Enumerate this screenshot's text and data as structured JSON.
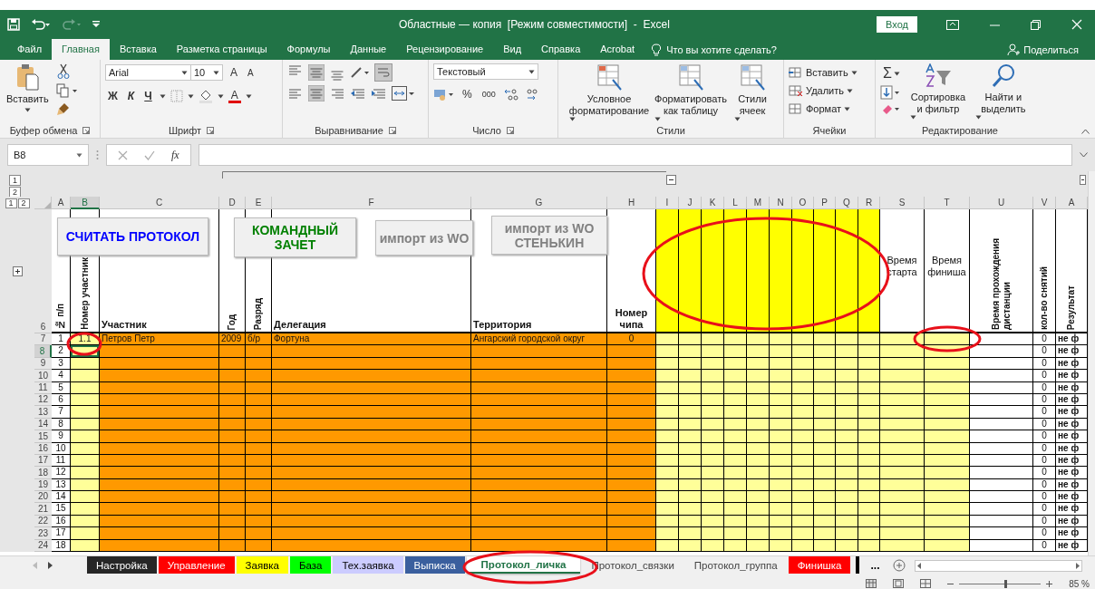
{
  "title_bar": {
    "title": "Областные — копия  [Режим совместимости]  -  Excel",
    "sign_in": "Вход"
  },
  "ribbon_tabs": [
    {
      "label": "Файл",
      "selected": false
    },
    {
      "label": "Главная",
      "selected": true
    },
    {
      "label": "Вставка",
      "selected": false
    },
    {
      "label": "Разметка страницы",
      "selected": false
    },
    {
      "label": "Формулы",
      "selected": false
    },
    {
      "label": "Данные",
      "selected": false
    },
    {
      "label": "Рецензирование",
      "selected": false
    },
    {
      "label": "Вид",
      "selected": false
    },
    {
      "label": "Справка",
      "selected": false
    },
    {
      "label": "Acrobat",
      "selected": false
    }
  ],
  "tell_me": "Что вы хотите сделать?",
  "share": "Поделиться",
  "ribbon": {
    "clipboard": {
      "paste": "Вставить",
      "label": "Буфер обмена"
    },
    "font": {
      "font_name": "Arial",
      "font_size": "10",
      "grow": "A",
      "shrink": "A",
      "bold": "Ж",
      "italic": "К",
      "underline": "Ч",
      "font_color": "A",
      "label": "Шрифт"
    },
    "alignment": {
      "label": "Выравнивание"
    },
    "number": {
      "format": "Текстовый",
      "percent": "%",
      "thousands": "000",
      "label": "Число"
    },
    "styles": {
      "buttons": [
        "Условное форматирование",
        "Форматировать как таблицу",
        "Стили ячеек"
      ],
      "label": "Стили"
    },
    "cells": {
      "buttons": [
        "Вставить",
        "Удалить",
        "Формат"
      ],
      "label": "Ячейки"
    },
    "editing": {
      "sum": "Σ",
      "buttons": [
        "Сортировка и фильтр",
        "Найти и выделить"
      ],
      "label": "Редактирование"
    }
  },
  "formula_bar": {
    "name_box": "B8",
    "function_label": "fx"
  },
  "outline": {
    "row_levels": [
      "1",
      "2"
    ],
    "column_levels": [
      "1",
      "2"
    ]
  },
  "sheet_buttons": [
    {
      "label": "СЧИТАТЬ ПРОТОКОЛ",
      "color": "#0000ff"
    },
    {
      "label": "КОМАНДНЫЙ ЗАЧЕТ",
      "color": "#008000"
    },
    {
      "label": "импорт из WO",
      "color": "#808080"
    },
    {
      "label": "импорт из WO СТЕНЬКИН",
      "color": "#808080"
    }
  ],
  "header_row": "6",
  "columns": [
    {
      "letter": "A",
      "header": "№ п/п",
      "kind": "vertical",
      "color": "#ffffff",
      "selected": false
    },
    {
      "letter": "B",
      "header": "Номер участник",
      "kind": "vertical",
      "color": "#ffff99",
      "selected": true
    },
    {
      "letter": "C",
      "header": "Участник",
      "kind": "bottom",
      "color": "#ff9900",
      "selected": false
    },
    {
      "letter": "D",
      "header": "Год",
      "kind": "vertical",
      "color": "#ff9900",
      "selected": false
    },
    {
      "letter": "E",
      "header": "Разряд",
      "kind": "vertical",
      "color": "#ff9900",
      "selected": false
    },
    {
      "letter": "F",
      "header": "Делегация",
      "kind": "bottom",
      "color": "#ff9900",
      "selected": false
    },
    {
      "letter": "G",
      "header": "Территория",
      "kind": "bottom",
      "color": "#ff9900",
      "selected": false
    },
    {
      "letter": "H",
      "header": "Номер чипа",
      "kind": "centered",
      "color": "#ff9900",
      "selected": false
    },
    {
      "letter": "I",
      "header_cell": {
        "color": "#ffff00"
      },
      "color": "#ffff99",
      "selected": false
    },
    {
      "letter": "J",
      "header_cell": {
        "color": "#ffff00"
      },
      "color": "#ffff99",
      "selected": false
    },
    {
      "letter": "K",
      "header_cell": {
        "color": "#ffff00"
      },
      "color": "#ffff99",
      "selected": false
    },
    {
      "letter": "L",
      "header_cell": {
        "color": "#ffff00"
      },
      "color": "#ffff99",
      "selected": false
    },
    {
      "letter": "M",
      "header_cell": {
        "color": "#ffff00"
      },
      "color": "#ffff99",
      "selected": false
    },
    {
      "letter": "N",
      "header_cell": {
        "color": "#ffff00"
      },
      "color": "#ffff99",
      "selected": false
    },
    {
      "letter": "O",
      "header_cell": {
        "color": "#ffff00"
      },
      "color": "#ffff99",
      "selected": false
    },
    {
      "letter": "P",
      "header_cell": {
        "color": "#ffff00"
      },
      "color": "#ffff99",
      "selected": false
    },
    {
      "letter": "Q",
      "header_cell": {
        "color": "#ffff00"
      },
      "color": "#ffff99",
      "selected": false
    },
    {
      "letter": "R",
      "header_cell": {
        "color": "#ffff00"
      },
      "color": "#ffff99",
      "selected": false
    },
    {
      "letter": "S",
      "header": "Время старта",
      "kind": "middle",
      "color": "#ffff99",
      "selected": false
    },
    {
      "letter": "T",
      "header": "Время финиша",
      "kind": "middle",
      "color": "#ffff99",
      "selected": false
    },
    {
      "letter": "U",
      "header": "Время прохождения дистанции",
      "kind": "vertical",
      "color": "#ffffff",
      "selected": false
    },
    {
      "letter": "V",
      "header": "кол-во снятий",
      "kind": "vertical",
      "color": "#ffffff",
      "selected": false
    },
    {
      "letter": "A",
      "header": "Результат",
      "kind": "vertical",
      "color": "#ffffff",
      "selected": false
    }
  ],
  "rows": [
    {
      "number": "7",
      "selected": false,
      "cells": [
        "1",
        "1.1",
        "Петров Петр",
        "2009",
        "б/р",
        "Фортуна",
        "Ангарский городской округ",
        "0"
      ],
      "removals": "0",
      "result": "не ф"
    },
    {
      "number": "8",
      "selected": true,
      "cells": [
        "2"
      ],
      "removals": "0",
      "result": "не ф"
    },
    {
      "number": "9",
      "selected": false,
      "cells": [
        "3"
      ],
      "removals": "0",
      "result": "не ф"
    },
    {
      "number": "10",
      "selected": false,
      "cells": [
        "4"
      ],
      "removals": "0",
      "result": "не ф"
    },
    {
      "number": "11",
      "selected": false,
      "cells": [
        "5"
      ],
      "removals": "0",
      "result": "не ф"
    },
    {
      "number": "12",
      "selected": false,
      "cells": [
        "6"
      ],
      "removals": "0",
      "result": "не ф"
    },
    {
      "number": "13",
      "selected": false,
      "cells": [
        "7"
      ],
      "removals": "0",
      "result": "не ф"
    },
    {
      "number": "14",
      "selected": false,
      "cells": [
        "8"
      ],
      "removals": "0",
      "result": "не ф"
    },
    {
      "number": "15",
      "selected": false,
      "cells": [
        "9"
      ],
      "removals": "0",
      "result": "не ф"
    },
    {
      "number": "16",
      "selected": false,
      "cells": [
        "10"
      ],
      "removals": "0",
      "result": "не ф"
    },
    {
      "number": "17",
      "selected": false,
      "cells": [
        "11"
      ],
      "removals": "0",
      "result": "не ф"
    },
    {
      "number": "18",
      "selected": false,
      "cells": [
        "12"
      ],
      "removals": "0",
      "result": "не ф"
    },
    {
      "number": "19",
      "selected": false,
      "cells": [
        "13"
      ],
      "removals": "0",
      "result": "не ф"
    },
    {
      "number": "20",
      "selected": false,
      "cells": [
        "14"
      ],
      "removals": "0",
      "result": "не ф"
    },
    {
      "number": "21",
      "selected": false,
      "cells": [
        "15"
      ],
      "removals": "0",
      "result": "не ф"
    },
    {
      "number": "22",
      "selected": false,
      "cells": [
        "16"
      ],
      "removals": "0",
      "result": "не ф"
    },
    {
      "number": "23",
      "selected": false,
      "cells": [
        "17"
      ],
      "removals": "0",
      "result": "не ф"
    },
    {
      "number": "24",
      "selected": false,
      "cells": [
        "18"
      ],
      "removals": "0",
      "result": "не ф"
    }
  ],
  "sheet_tabs": [
    {
      "label": "Настройка",
      "color": "#262626",
      "selected": false
    },
    {
      "label": "Управление",
      "color": "#ff0000",
      "selected": false
    },
    {
      "label": "Заявка",
      "color": "#ffff00",
      "selected": false
    },
    {
      "label": "База",
      "color": "#00ff00",
      "selected": false
    },
    {
      "label": "Тех.заявка",
      "color": "#ccccff",
      "selected": false
    },
    {
      "label": "Выписка",
      "color": "#3a5f9e",
      "selected": false
    },
    {
      "label": "Протокол_личка",
      "selected": true
    },
    {
      "label": "Протокол_связки",
      "selected": false
    },
    {
      "label": "Протокол_группа",
      "selected": false
    },
    {
      "label": "Финишка",
      "color": "#ff0000",
      "selected": false
    }
  ],
  "more_tabs": "...",
  "status_bar": {
    "zoom": "85 %",
    "zoom_slider": {
      "level": 0.55
    }
  }
}
